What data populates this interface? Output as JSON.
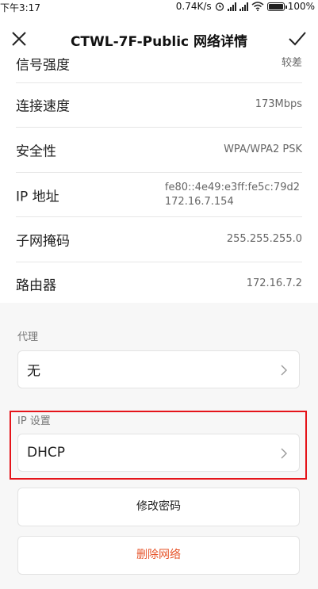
{
  "status_bar": {
    "time": "下午3:17",
    "network_speed": "0.74K/s",
    "battery": "100%",
    "icons": [
      "alarm-icon",
      "signal-icon",
      "signal-hd-icon",
      "wifi-icon",
      "battery-icon"
    ]
  },
  "header": {
    "title": "CTWL-7F-Public  网络详情",
    "close_icon": "close-icon",
    "confirm_icon": "check-icon"
  },
  "details": {
    "partial_row": {
      "label": "信号强度",
      "value": "较差"
    },
    "rows": [
      {
        "label": "连接速度",
        "value": "173Mbps"
      },
      {
        "label": "安全性",
        "value": "WPA/WPA2 PSK"
      },
      {
        "label": "IP 地址",
        "value_line1": "fe80::4e49:e3ff:fe5c:79d2",
        "value_line2": "172.16.7.154"
      },
      {
        "label": "子网掩码",
        "value": "255.255.255.0"
      },
      {
        "label": "路由器",
        "value": "172.16.7.2"
      }
    ]
  },
  "proxy": {
    "section_label": "代理",
    "value": "无"
  },
  "ip_settings": {
    "section_label": "IP 设置",
    "value": "DHCP"
  },
  "actions": {
    "modify_password": "修改密码",
    "delete_network": "删除网络"
  },
  "colors": {
    "danger": "#e6542a",
    "highlight_box": "#e5141a",
    "background": "#f7f7f7"
  }
}
